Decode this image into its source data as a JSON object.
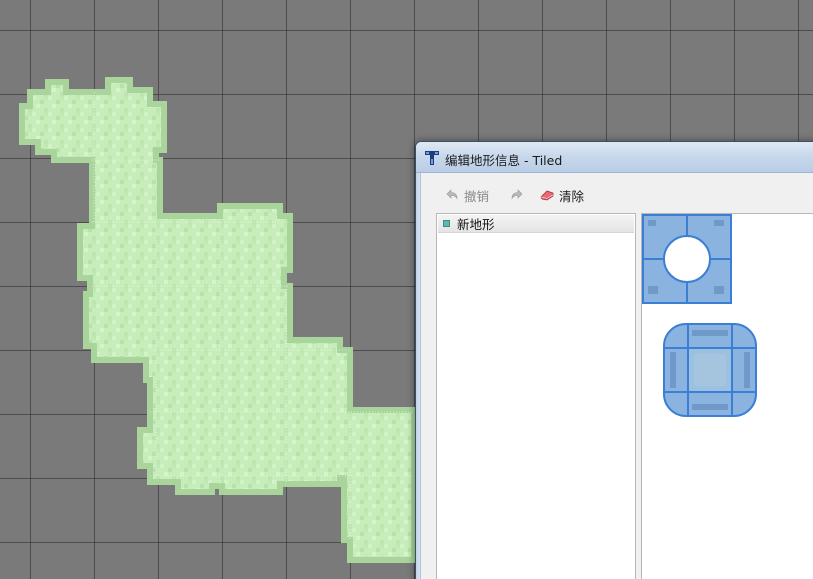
{
  "map": {
    "grid": "on",
    "background_color": "#7a7a7a",
    "terrain_fill": "#c6edba",
    "terrain_edge": "#a9d49b"
  },
  "dialog": {
    "title": "编辑地形信息 - Tiled",
    "app_icon": "tiled-icon"
  },
  "toolbar": {
    "undo_label": "撤销",
    "undo_icon": "undo-icon",
    "redo_icon": "redo-icon",
    "clear_label": "清除",
    "clear_icon": "eraser-icon"
  },
  "terrain_list": {
    "items": [
      {
        "label": "新地形",
        "color": "#5cb8b0"
      }
    ]
  },
  "tileset": {
    "selection_color": "#3a7fd4",
    "tiles": [
      "terrain-corner-inner-tile",
      "terrain-full-tile"
    ]
  }
}
